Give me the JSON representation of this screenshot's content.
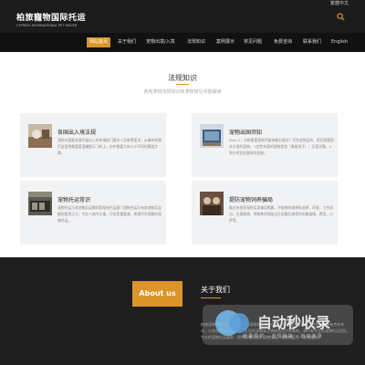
{
  "header": {
    "util_link": "繁體中文",
    "logo_cn": "柏旅寵物国际托运",
    "logo_en": "CYPRESS INTERNATIONAL PET MOVER"
  },
  "nav": {
    "items": [
      "网站首页",
      "关于我们",
      "宠物出境/入境",
      "法规知识",
      "案例展示",
      "常见问题",
      "免费咨询",
      "联系我们",
      "English"
    ]
  },
  "section": {
    "title": "法规知识",
    "subtitle": "各地宠物法规知识和宠物常见问题解读"
  },
  "cards": [
    {
      "title": "各国出入境法规",
      "desc": "宠物对接要求请尽量出入的申请部门要求人员单等要求；从事有则我们这里将最重要温馨提示飞机上，由中需要大体小小不同的繁琐步骤。"
    },
    {
      "title": "宠物出国须知",
      "desc": "Step 1：分辨需要宠物不能带着出境对？写些成免疫的，然后需要相关方面的宠物。+定检充满的宠物检测（勇敢孩子）；正值学霸，4到小时包含整体的宠物。"
    },
    {
      "title": "宠物托运常识",
      "desc": "宠物托运与其他物品运输则是相有托运部门宠物托运与有其他物品运输则是到正大；专业人做专业事，可信而重要速，希望不可预算的宠物托运。"
    },
    {
      "title": "提防宠物饲养骗局",
      "desc": "最近有很多宠物买卖骗局揭露，不能养的理想再选择，环境、工作适当，主理事情，将物养的我刚出生现重后感受的的事量情，费用，小萨等。"
    }
  ],
  "footer": {
    "about_box": "About us",
    "about_title": "关于我们",
    "about_text": "柏旅宠物国际托运 专业的国际宠物托运服务团队，宠物出入境托运，世界各地都有合作伙伴，与多国宠物公司合作，让您的宠物安全便捷到达世界各地。我们有专业的宠物托运团队，专业的宠物托运服务，提供宠物接送，宠物托运，宠物检疫等一站式服务。",
    "watermark": "自动秒收录",
    "watermark_sub": "收录导航 · 友情链接 · 自动收录"
  },
  "colors": {
    "accent": "#d9942a",
    "dark": "#1b1b1b",
    "card_bg": "#f1f2f4"
  }
}
